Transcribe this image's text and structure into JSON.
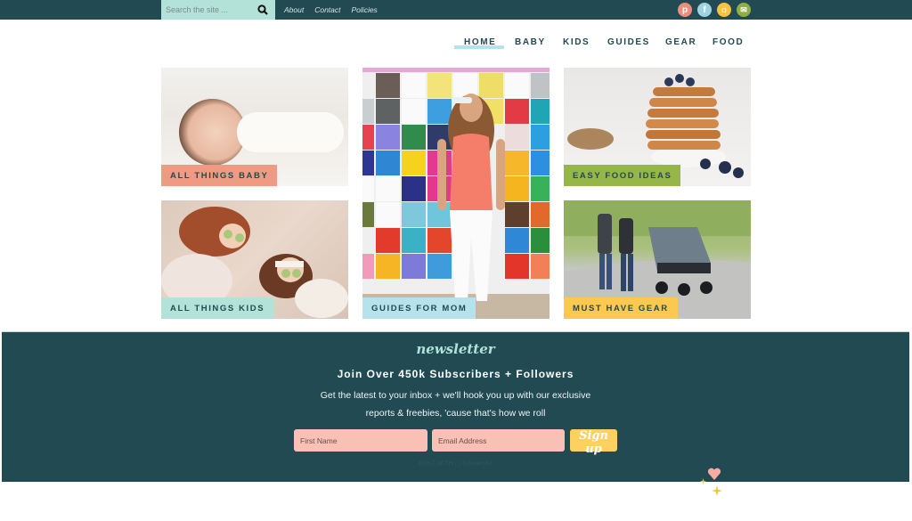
{
  "topbar": {
    "search_placeholder": "Search the site ...",
    "links": [
      "About",
      "Contact",
      "Policies"
    ],
    "social": [
      {
        "icon": "pinterest-icon",
        "glyph": "p",
        "color": "#e8907c"
      },
      {
        "icon": "facebook-icon",
        "glyph": "f",
        "color": "#9ed3df"
      },
      {
        "icon": "instagram-icon",
        "glyph": "◘",
        "color": "#f5c243"
      },
      {
        "icon": "email-icon",
        "glyph": "✉",
        "color": "#8fae45"
      }
    ]
  },
  "nav": {
    "items": [
      "HOME",
      "BABY",
      "KIDS",
      "GUIDES",
      "GEAR",
      "FOOD"
    ],
    "active": "HOME"
  },
  "tiles": [
    {
      "label": "ALL THINGS BABY",
      "label_color": "#ef9a82"
    },
    {
      "label": "GUIDES FOR MOM",
      "label_color": "#b7e2ec"
    },
    {
      "label": "EASY FOOD IDEAS",
      "label_color": "#96b64a"
    },
    {
      "label": "ALL THINGS KIDS",
      "label_color": "#b3e3d8"
    },
    {
      "label": "MUST HAVE GEAR",
      "label_color": "#fbc94f"
    }
  ],
  "newsletter": {
    "script_title": "newsletter",
    "title": "Join Over 450k Subscribers + Followers",
    "body_line1": "Get the latest to your inbox + we'll hook you up with our exclusive",
    "body_line2": "reports & freebies, 'cause that's how we roll",
    "first_name_placeholder": "First Name",
    "email_placeholder": "Email Address",
    "submit_label": "Sign up",
    "built_with": "BUILT WITH ◯ ConvertKit"
  },
  "colors": {
    "brand_dark": "#214a52",
    "mint": "#b3e3d8",
    "coral": "#f9c1b5",
    "yellow": "#fdd160"
  }
}
